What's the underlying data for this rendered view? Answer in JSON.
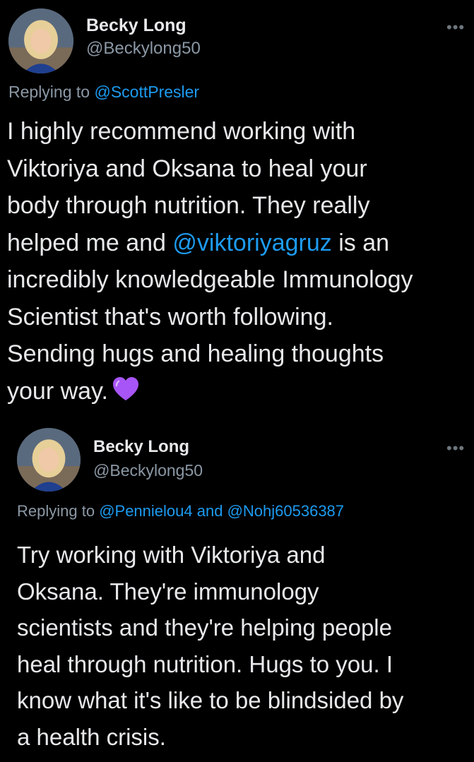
{
  "tweets": [
    {
      "author_name": "Becky Long",
      "author_handle": "@Beckylong50",
      "more_icon": "more-icon",
      "replying_to_prefix": "Replying to ",
      "replying_to_link": "@ScottPresler",
      "text_lines": [
        "I highly recommend working with",
        "Viktoriya and Oksana to heal your",
        "body through nutrition. They really",
        "helped me and ",
        "@viktoriyagruz",
        " is an",
        "incredibly knowledgeable Immunology",
        "Scientist that's worth following.",
        "Sending hugs and healing thoughts",
        "your way."
      ],
      "emoji": "purple-heart-icon"
    },
    {
      "author_name": "Becky Long",
      "author_handle": "@Beckylong50",
      "more_icon": "more-icon",
      "replying_to_prefix": "Replying to ",
      "replying_to_link_1": "@Pennielou4",
      "replying_to_and": " and ",
      "replying_to_link_2": "@Nohj60536387",
      "text_lines": [
        "Try working with Viktoriya and",
        "Oksana. They're immunology",
        "scientists and they're helping people",
        "heal through nutrition. Hugs to you. I",
        "know what it's like to be blindsided by",
        "a health crisis."
      ]
    }
  ],
  "colors": {
    "background": "#000000",
    "text": "#e7e9ea",
    "secondary": "#8b98a5",
    "link": "#1d9bf0",
    "heart": "#a855f7"
  }
}
